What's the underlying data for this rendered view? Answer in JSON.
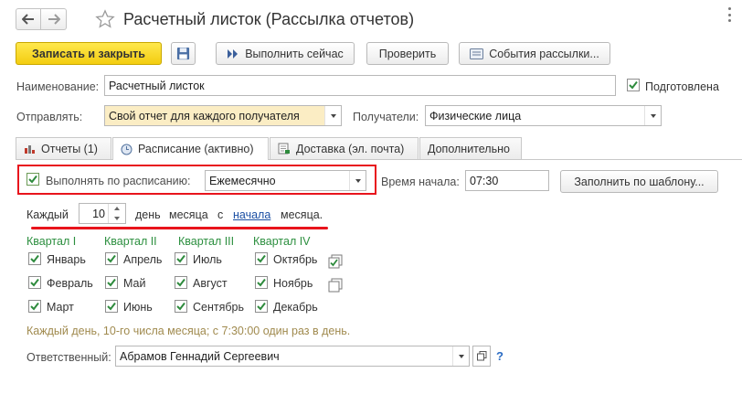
{
  "window": {
    "title": "Расчетный листок (Рассылка отчетов)"
  },
  "toolbar": {
    "save_close_label": "Записать и закрыть",
    "run_now_label": "Выполнить сейчас",
    "check_label": "Проверить",
    "events_label": "События рассылки..."
  },
  "form": {
    "name_label": "Наименование:",
    "name_value": "Расчетный листок",
    "prepared_label": "Подготовлена",
    "prepared_checked": true,
    "send_label": "Отправлять:",
    "send_value": "Свой отчет для каждого получателя",
    "recipients_label": "Получатели:",
    "recipients_value": "Физические лица"
  },
  "tabs": [
    {
      "label": "Отчеты (1)",
      "icon": "chart-icon",
      "active": false
    },
    {
      "label": "Расписание (активно)",
      "icon": "clock-icon",
      "active": true
    },
    {
      "label": "Доставка (эл. почта)",
      "icon": "envelope-icon",
      "active": false
    },
    {
      "label": "Дополнительно",
      "icon": "",
      "active": false
    }
  ],
  "schedule": {
    "run_label": "Выполнять по расписанию:",
    "run_checked": true,
    "period_value": "Ежемесячно",
    "start_time_label": "Время начала:",
    "start_time_value": "07:30",
    "fill_template_label": "Заполнить по шаблону...",
    "every_label": "Каждый",
    "day_value": "10",
    "day_of_month_label": "день",
    "month_from_label": "месяца",
    "from_label": "с",
    "start_link": "начала",
    "month_end_label": "месяца."
  },
  "quarters": [
    {
      "label": "Квартал I",
      "months": [
        {
          "label": "Январь",
          "checked": true
        },
        {
          "label": "Февраль",
          "checked": true
        },
        {
          "label": "Март",
          "checked": true
        }
      ]
    },
    {
      "label": "Квартал II",
      "months": [
        {
          "label": "Апрель",
          "checked": true
        },
        {
          "label": "Май",
          "checked": true
        },
        {
          "label": "Июнь",
          "checked": true
        }
      ]
    },
    {
      "label": "Квартал III",
      "months": [
        {
          "label": "Июль",
          "checked": true
        },
        {
          "label": "Август",
          "checked": true
        },
        {
          "label": "Сентябрь",
          "checked": true
        }
      ]
    },
    {
      "label": "Квартал IV",
      "months": [
        {
          "label": "Октябрь",
          "checked": true
        },
        {
          "label": "Ноябрь",
          "checked": true
        },
        {
          "label": "Декабрь",
          "checked": true
        }
      ]
    }
  ],
  "summary": "Каждый день, 10-го числа месяца; с 7:30:00 один раз в день.",
  "responsible": {
    "label": "Ответственный:",
    "value": "Абрамов Геннадий Сергеевич",
    "help": "?"
  },
  "colors": {
    "accent_yellow": "#f3cd10",
    "highlight_red": "#e8141c",
    "quarter_green": "#2c8f3f",
    "link_blue": "#1c4fa3"
  }
}
